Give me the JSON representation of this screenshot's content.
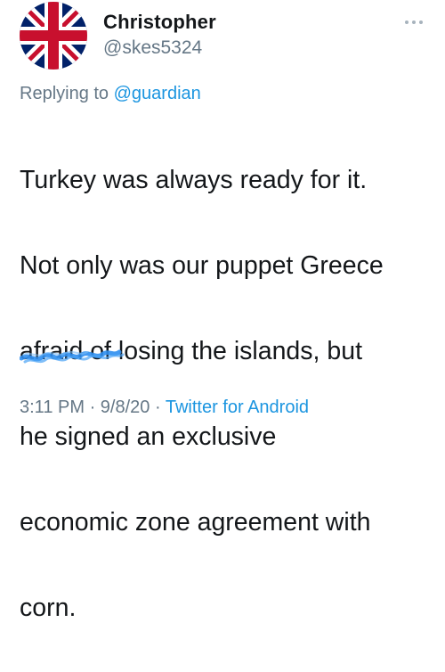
{
  "tweet": {
    "author": {
      "display_name": "Christopher",
      "handle": "@skes5324",
      "avatar_icon": "union-jack-flag-icon"
    },
    "more_icon": "more-options-icon",
    "replying_prefix": "Replying to",
    "replying_to": "@guardian",
    "lines": [
      "Turkey was always ready for it.",
      "Not only was our puppet Greece",
      "afraid of losing the islands, but",
      "he signed an exclusive",
      "economic zone agreement with",
      "corn."
    ],
    "time": "3:11 PM",
    "separator": "·",
    "date": "9/8/20",
    "source": "Twitter for Android"
  },
  "colors": {
    "text": "#14171a",
    "secondary": "#657786",
    "link": "#1b95e0",
    "scribble": "#2d8ef0"
  }
}
